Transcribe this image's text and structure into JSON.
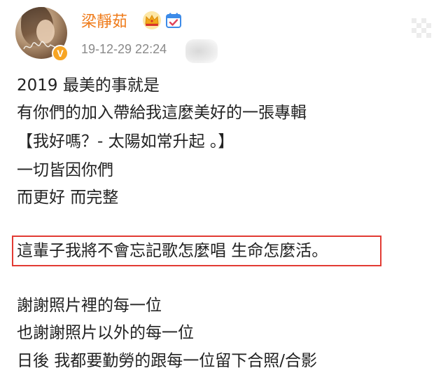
{
  "author": {
    "name": "梁靜茹",
    "verified_badge": "V",
    "badge_color": "#f7a524",
    "name_color": "#ef7b1a",
    "icons": [
      "crown-icon",
      "calendar-check-icon"
    ]
  },
  "post": {
    "timestamp": "19-12-29 22:24",
    "lines": [
      "2019 最美的事就是",
      "有你們的加入帶給我這麼美好的一張專輯",
      "【我好嗎？- 太陽如常升起 。】",
      "一切皆因你們",
      "而更好  而完整",
      "",
      "這輩子我將不會忘記歌怎麼唱 生命怎麼活。",
      "",
      "謝謝照片裡的每一位",
      "也謝謝照片以外的每一位",
      "日後 我都要勤勞的跟每一位留下合照/合影"
    ],
    "highlight_color": "#e23b34"
  }
}
